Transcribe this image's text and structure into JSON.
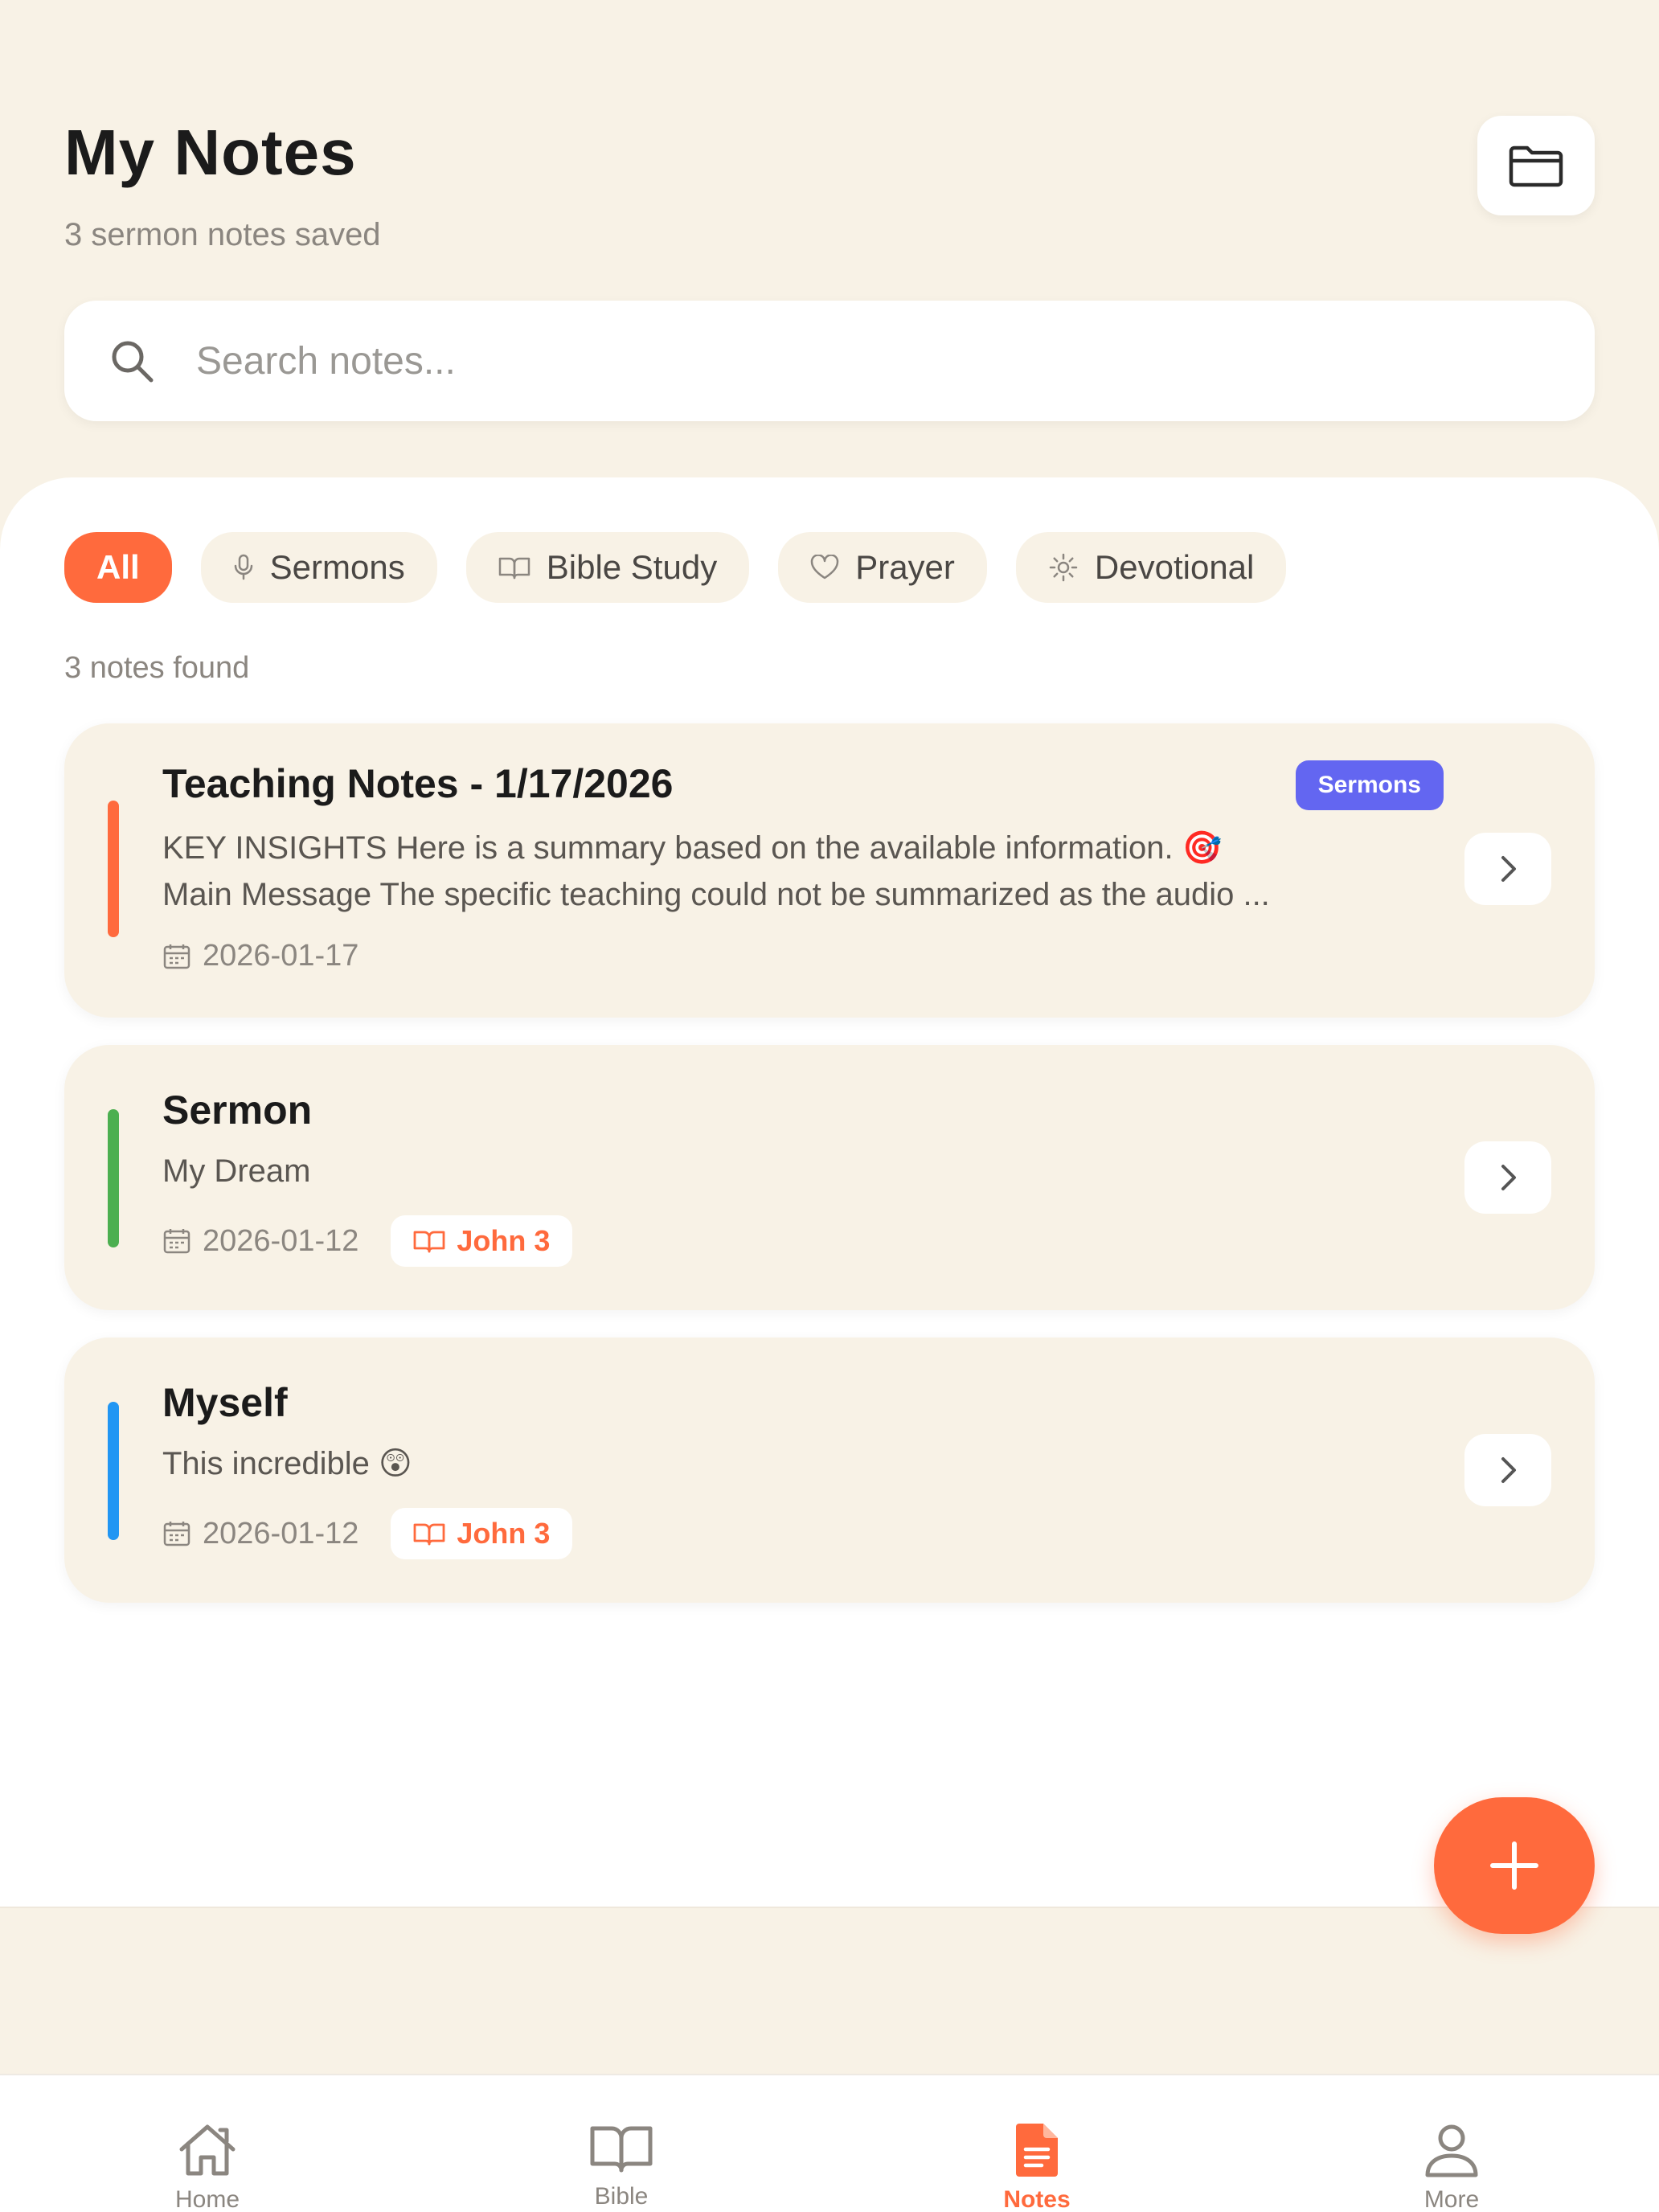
{
  "header": {
    "title": "My Notes",
    "subtitle": "3 sermon notes saved",
    "folder_icon": "folder-icon"
  },
  "search": {
    "placeholder": "Search notes...",
    "icon": "search-icon"
  },
  "filters": {
    "chips": [
      {
        "label": "All",
        "icon": null,
        "active": true
      },
      {
        "label": "Sermons",
        "icon": "microphone-icon",
        "active": false
      },
      {
        "label": "Bible Study",
        "icon": "book-open-icon",
        "active": false
      },
      {
        "label": "Prayer",
        "icon": "heart-icon",
        "active": false
      },
      {
        "label": "Devotional",
        "icon": "sun-icon",
        "active": false
      }
    ]
  },
  "results": {
    "count_text": "3 notes found"
  },
  "notes": [
    {
      "title": "Teaching Notes - 1/17/2026",
      "category": "Sermons",
      "preview_line1": "KEY INSIGHTS Here is a summary based on the available information. 🎯",
      "preview_line2": "Main Message The specific teaching could not be summarized as the audio ...",
      "date": "2026-01-17",
      "accent_color": "#FF6A3D"
    },
    {
      "title": "Sermon",
      "preview_line1": "My Dream",
      "date": "2026-01-12",
      "reference": "John 3",
      "accent_color": "#4CAF50"
    },
    {
      "title": "Myself",
      "preview_line1": "This incredible 😲",
      "date": "2026-01-12",
      "reference": "John 3",
      "accent_color": "#2196F3"
    }
  ],
  "fab": {
    "icon": "plus-icon"
  },
  "nav": {
    "items": [
      {
        "label": "Home",
        "icon": "home-icon",
        "active": false
      },
      {
        "label": "Bible",
        "icon": "book-icon",
        "active": false
      },
      {
        "label": "Notes",
        "icon": "notes-icon",
        "active": true
      },
      {
        "label": "More",
        "icon": "user-icon",
        "active": false
      }
    ]
  },
  "colors": {
    "accent": "#FF6A3D",
    "background": "#F8F2E6",
    "badge_purple": "#6366F1"
  }
}
